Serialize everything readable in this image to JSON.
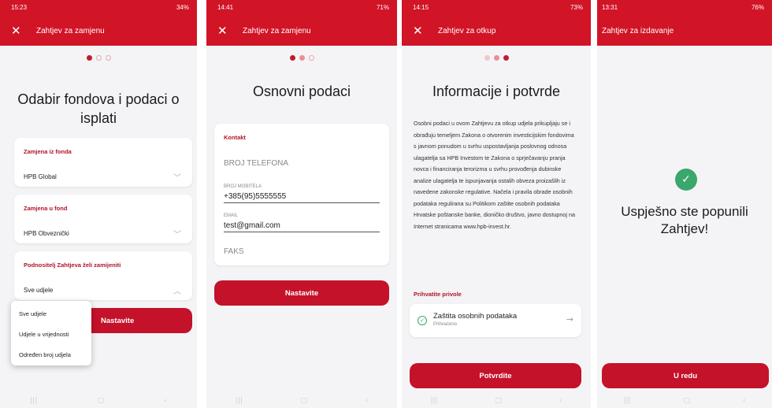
{
  "screen1": {
    "status_time": "15:23",
    "status_right": "34%",
    "title": "Zahtjev za zamjenu",
    "heading": "Odabir fondova i podaci o isplati",
    "fields": [
      {
        "label": "Zamjena iz fonda",
        "value": "HPB Global"
      },
      {
        "label": "Zamjena u fond",
        "value": "HPB Obveznički"
      },
      {
        "label": "Podnositelj Zahtjeva želi zamijeniti",
        "value": "Sve udjele"
      }
    ],
    "button_label": "Nastavite",
    "dropdown_options": [
      "Sve udjele",
      "Udjele u vrijednosti",
      "Određen broj udjela"
    ]
  },
  "screen2": {
    "status_time": "14:41",
    "status_right": "71%",
    "title": "Zahtjev za zamjenu",
    "heading": "Osnovni podaci",
    "section_label": "Kontakt",
    "phone_placeholder": "BROJ TELEFONA",
    "mobile_label": "BROJ MOBITELA",
    "mobile_value": "+385(95)5555555",
    "email_label": "EMAIL",
    "email_value": "test@gmail.com",
    "fax_placeholder": "FAKS",
    "button_label": "Nastavite"
  },
  "screen3": {
    "status_time": "14:15",
    "status_right": "73%",
    "title": "Zahtjev za otkup",
    "heading": "Informacije i potvrde",
    "paragraph": "Osobni podaci u ovom Zahtjevu za otkup udjela prikupljaju se i obrađuju temeljem Zakona o otvorenim investicijskim fondovima s javnom ponudom u svrhu uspostavljanja poslovnog odnosa ulagatelja sa HPB Investom te Zakona o sprječavanju pranja novca i financiranja terorizma u svrhu provođenja dubinske analize ulagatelja te ispunjavanja ostalih obveza proizašlih iz navedene zakonske regulative. Načela i pravila obrade osobnih podataka regulirana su Politikom zaštite osobnih podataka Hrvatske poštanske banke, dioničko društvo, javno dostupnoj na Internet stranicama www.hpb-invest.hr.",
    "consent_label": "Prihvatite privole",
    "consent_item_title": "Zaštita osobnih podataka",
    "consent_item_status": "Prihvaćeno",
    "button_label": "Potvrdite"
  },
  "screen4": {
    "status_time": "13:31",
    "status_right": "76%",
    "title": "Zahtjev za izdavanje",
    "message": "Uspješno ste popunili Zahtjev!",
    "button_label": "U redu"
  },
  "colors": {
    "brand_red": "#d11426",
    "success_green": "#3aa76d"
  },
  "icons": [
    "close-icon",
    "chevron-down-icon",
    "chevron-up-icon",
    "check-circle-icon",
    "arrow-right-icon"
  ]
}
